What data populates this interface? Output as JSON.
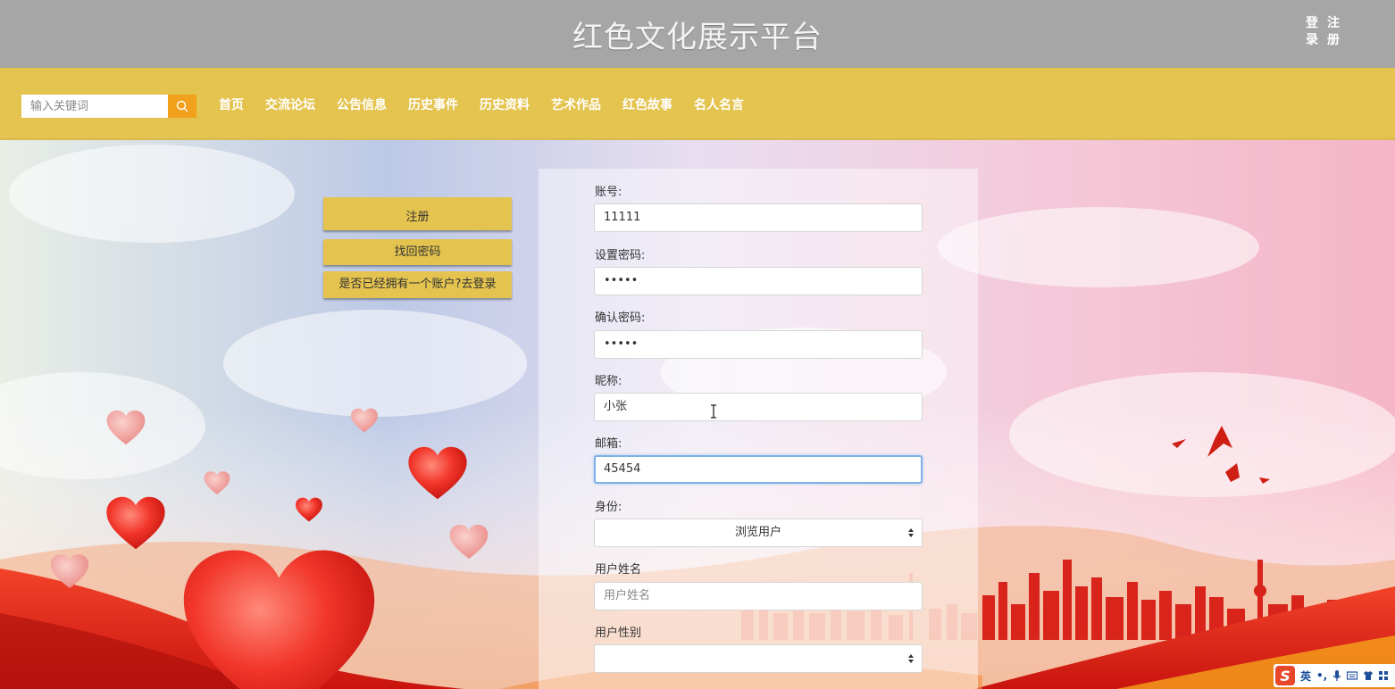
{
  "header": {
    "site_title": "红色文化展示平台",
    "login_label": "登录",
    "register_label": "注册"
  },
  "search": {
    "placeholder": "输入关键词",
    "icon": "search-icon"
  },
  "nav": {
    "items": [
      {
        "label": "首页"
      },
      {
        "label": "交流论坛"
      },
      {
        "label": "公告信息"
      },
      {
        "label": "历史事件"
      },
      {
        "label": "历史资料"
      },
      {
        "label": "艺术作品"
      },
      {
        "label": "红色故事"
      },
      {
        "label": "名人名言"
      }
    ]
  },
  "side_buttons": {
    "register": "注册",
    "find_password": "找回密码",
    "go_login": "是否已经拥有一个账户?去登录"
  },
  "form": {
    "account": {
      "label": "账号:",
      "value": "11111"
    },
    "password": {
      "label": "设置密码:",
      "value": "•••••"
    },
    "confirm_password": {
      "label": "确认密码:",
      "value": "•••••"
    },
    "nickname": {
      "label": "昵称:",
      "value": "小张"
    },
    "email": {
      "label": "邮箱:",
      "value": "45454"
    },
    "identity": {
      "label": "身份:",
      "value": "浏览用户"
    },
    "real_name": {
      "label": "用户姓名",
      "placeholder": "用户姓名"
    },
    "gender": {
      "label": "用户性别",
      "value": ""
    }
  },
  "ime": {
    "language": "英",
    "punct": "•,",
    "icons": [
      "sogou-logo-icon",
      "microphone-icon",
      "keyboard-icon",
      "skin-icon",
      "grid-icon"
    ]
  },
  "colors": {
    "topbar": "#a6a6a6",
    "navbar": "#e4c34f",
    "search_button": "#f1a11b",
    "focus_border": "#7fb1e8"
  }
}
